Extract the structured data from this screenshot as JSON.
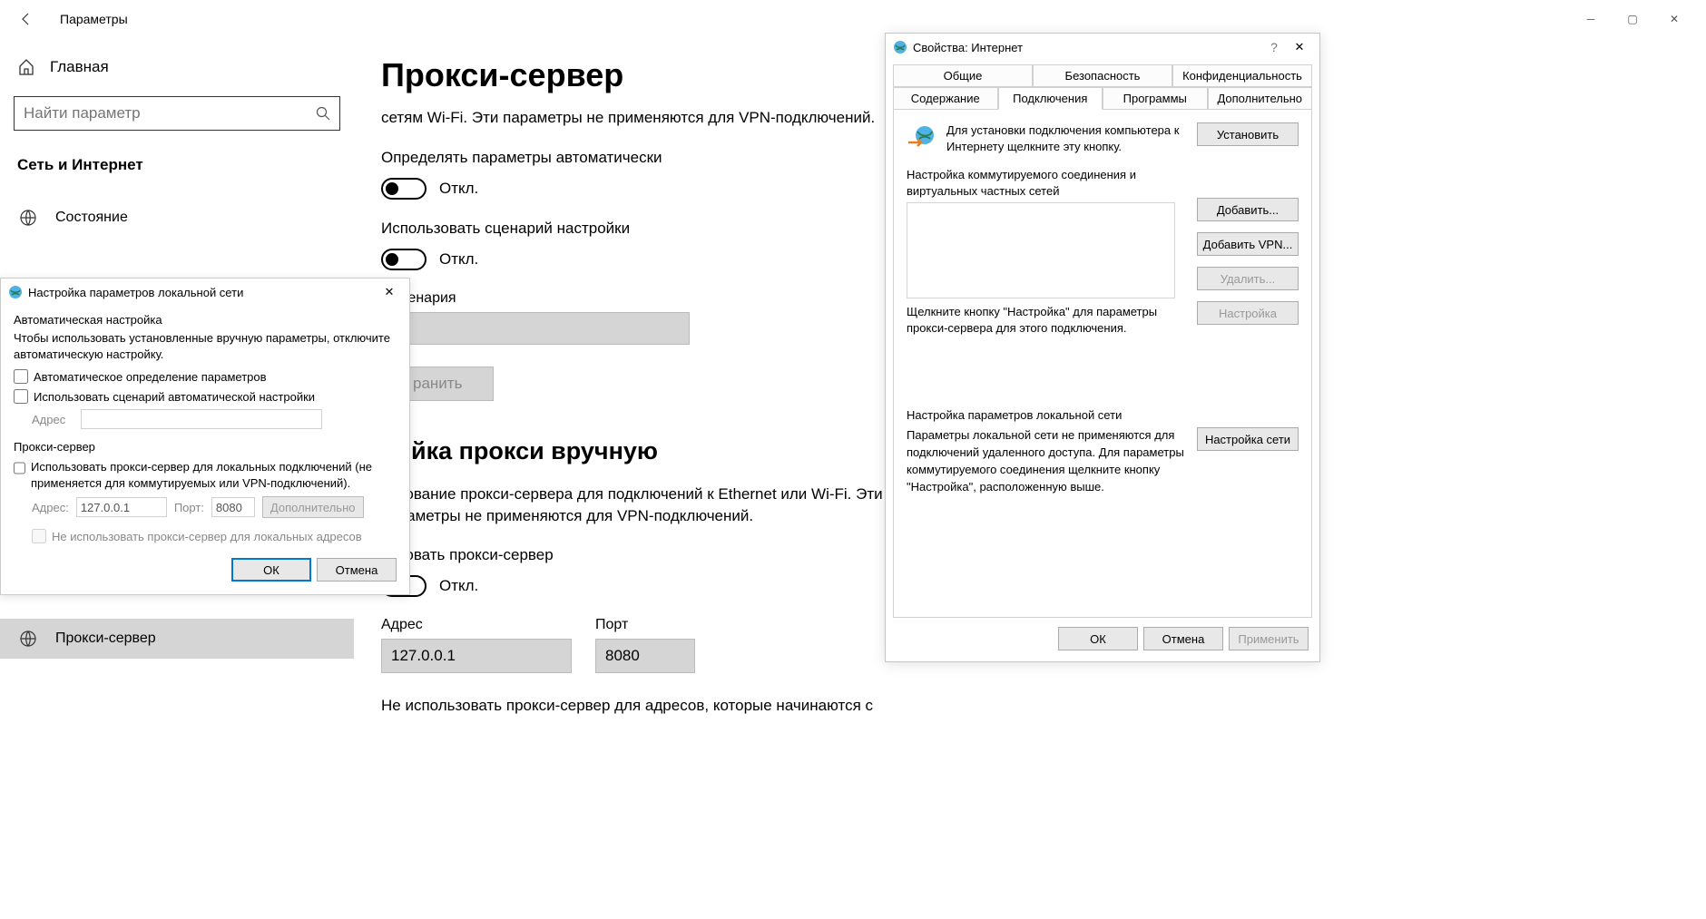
{
  "settings": {
    "title": "Параметры",
    "home": "Главная",
    "search_placeholder": "Найти параметр",
    "category": "Сеть и Интернет",
    "sidebar": {
      "status": "Состояние",
      "proxy": "Прокси-сервер"
    },
    "page": {
      "heading": "Прокси-сервер",
      "desc": "сетям Wi-Fi. Эти параметры не применяются для VPN-подключений.",
      "auto_detect": "Определять параметры автоматически",
      "off": "Откл.",
      "use_script": "Использовать сценарий настройки",
      "script_address": "с сценария",
      "save": "ранить",
      "manual_heading": "ройка прокси вручную",
      "manual_desc": "льзование прокси-сервера для подключений к Ethernet или Wi-Fi. Эти параметры не применяются для VPN-подключений.",
      "use_proxy_label": "льзовать прокси-сервер",
      "address_label": "Адрес",
      "port_label": "Порт",
      "address_value": "127.0.0.1",
      "port_value": "8080",
      "bypass_desc": "Не использовать прокси-сервер для адресов, которые начинаются с"
    }
  },
  "lan": {
    "title": "Настройка параметров локальной сети",
    "auto_group": "Автоматическая настройка",
    "auto_desc": "Чтобы использовать установленные вручную параметры, отключите автоматическую настройку.",
    "chk_auto_detect": "Автоматическое определение параметров",
    "chk_use_script": "Использовать сценарий автоматической настройки",
    "field_address": "Адрес",
    "proxy_group": "Прокси-сервер",
    "chk_use_proxy": "Использовать прокси-сервер для локальных подключений (не применяется для коммутируемых или VPN-подключений).",
    "addr_label": "Адрес:",
    "addr_value": "127.0.0.1",
    "port_label": "Порт:",
    "port_value": "8080",
    "btn_advanced": "Дополнительно",
    "chk_bypass": "Не использовать прокси-сервер для локальных адресов",
    "ok": "ОК",
    "cancel": "Отмена"
  },
  "inet": {
    "title": "Свойства: Интернет",
    "tabs_top": {
      "general": "Общие",
      "security": "Безопасность",
      "privacy": "Конфиденциальность"
    },
    "tabs_bottom": {
      "content": "Содержание",
      "connections": "Подключения",
      "programs": "Программы",
      "advanced": "Дополнительно"
    },
    "install_desc": "Для установки подключения компьютера к Интернету щелкните эту кнопку.",
    "btn_install": "Установить",
    "dial_label": "Настройка коммутируемого соединения и виртуальных частных сетей",
    "btn_add": "Добавить...",
    "btn_add_vpn": "Добавить VPN...",
    "btn_delete": "Удалить...",
    "btn_settings": "Настройка",
    "proxy_note": "Щелкните кнопку \"Настройка\" для параметры прокси-сервера для этого подключения.",
    "lan_sect_label": "Настройка параметров локальной сети",
    "lan_note": "Параметры локальной сети не применяются для подключений удаленного доступа. Для параметры коммутируемого соединения щелкните кнопку \"Настройка\", расположенную выше.",
    "btn_lan": "Настройка сети",
    "ok": "ОК",
    "cancel": "Отмена",
    "apply": "Применить"
  }
}
